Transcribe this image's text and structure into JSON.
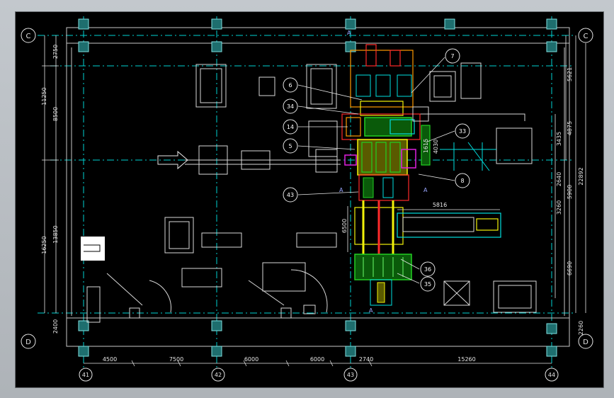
{
  "drawing": {
    "grid_rows": {
      "top": "C",
      "bottom": "D"
    },
    "grid_columns": [
      "41",
      "42",
      "43",
      "44"
    ],
    "bottom_dims": [
      "4500",
      "7500",
      "6000",
      "6000",
      "2740",
      "15260"
    ],
    "left_outer_dims": [
      "11250",
      "16250"
    ],
    "left_inner_dims": [
      "2750",
      "8500",
      "13850",
      "2400"
    ],
    "right_dims": [
      "5621",
      "4875",
      "3435",
      "2640",
      "22892",
      "3260",
      "5900",
      "6690",
      "2260"
    ],
    "callouts": [
      "6",
      "34",
      "14",
      "5",
      "43",
      "7",
      "33",
      "8",
      "36",
      "35"
    ],
    "dims_center": [
      "5816",
      "6500",
      "4030",
      "1615"
    ],
    "section_mark": "A"
  },
  "colors": {
    "background": "#000000",
    "grid_line": "#00d2d2",
    "structure": "#ffffff",
    "red": "#ff2a2a",
    "green": "#22d022",
    "yellow": "#f2f20a",
    "cyan": "#00e0e0",
    "magenta": "#e020e0",
    "orange": "#ff9a00"
  }
}
